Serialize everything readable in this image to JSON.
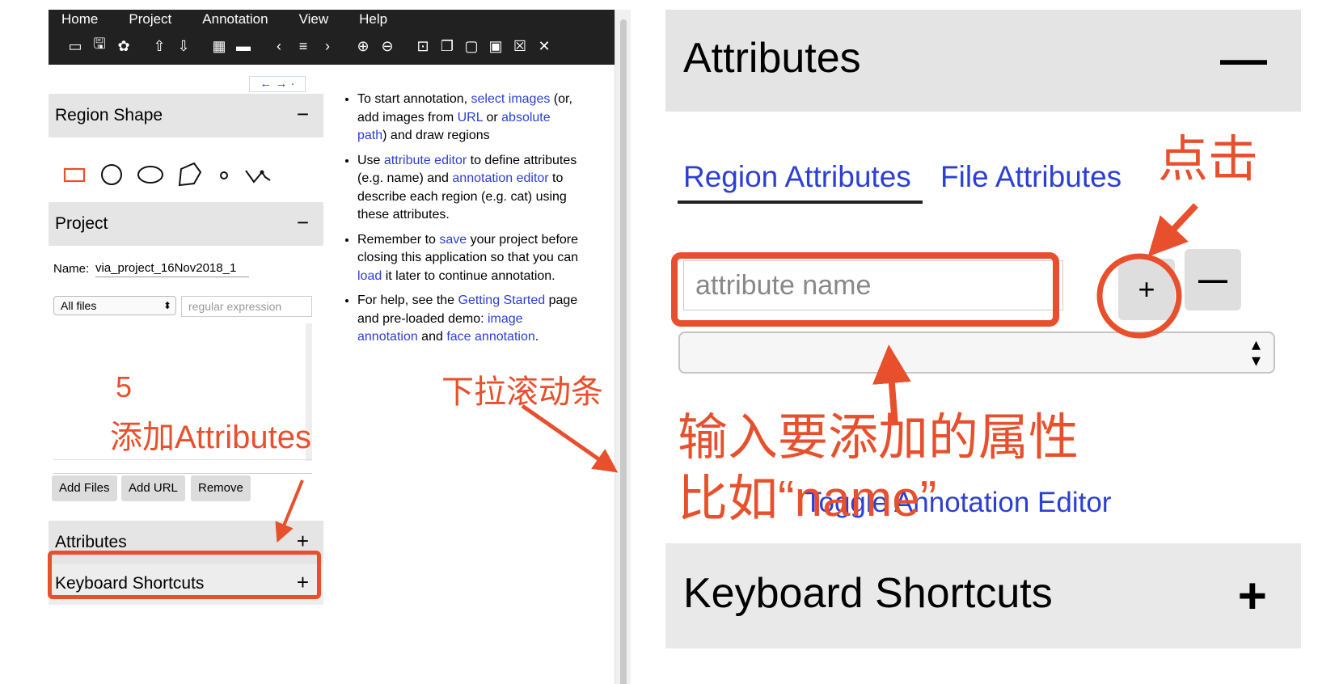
{
  "menu": [
    "Home",
    "Project",
    "Annotation",
    "View",
    "Help"
  ],
  "toolbar_icons": [
    "folder-open-icon",
    "save-icon",
    "settings-icon",
    "upload-icon",
    "download-icon",
    "grid-icon",
    "comment-icon",
    "prev-icon",
    "list-icon",
    "next-icon",
    "zoom-in-icon",
    "zoom-out-icon",
    "select-all-icon",
    "copy-icon",
    "paste-icon",
    "paste-n-icon",
    "delete-icon",
    "close-icon"
  ],
  "toolbar_glyphs": [
    "▭",
    "🖫",
    "✿",
    "⇧",
    "⇩",
    "▦",
    "▬",
    "‹",
    "≡",
    "›",
    "⊕",
    "⊖",
    "⊡",
    "❐",
    "▢",
    "▣",
    "☒",
    "✕"
  ],
  "sidebar": {
    "nav_arrows": "← → ·",
    "region_shape": {
      "title": "Region Shape",
      "toggle": "−"
    },
    "project": {
      "title": "Project",
      "toggle": "−",
      "name_label": "Name:",
      "name_value": "via_project_16Nov2018_1",
      "filter_selected": "All files",
      "regex_placeholder": "regular expression"
    },
    "buttons": {
      "add_files": "Add Files",
      "add_url": "Add URL",
      "remove": "Remove"
    },
    "attributes": {
      "title": "Attributes",
      "toggle": "+"
    },
    "keyboard": {
      "title": "Keyboard Shortcuts",
      "toggle": "+"
    }
  },
  "help": {
    "b1_t1": "To start annotation, ",
    "b1_l1": "select images",
    "b1_t2": " (or, add images from ",
    "b1_l2": "URL",
    "b1_t3": " or ",
    "b1_l3": "absolute path",
    "b1_t4": ") and draw regions",
    "b2_t1": "Use ",
    "b2_l1": "attribute editor",
    "b2_t2": " to define attributes (e.g. name) and ",
    "b2_l2": "annotation editor",
    "b2_t3": " to describe each region (e.g. cat) using these attributes.",
    "b3_t1": "Remember to ",
    "b3_l1": "save",
    "b3_t2": " your project before closing this application so that you can ",
    "b3_l2": "load",
    "b3_t3": " it later to continue annotation.",
    "b4_t1": "For help, see the ",
    "b4_l1": "Getting Started",
    "b4_t2": " page and pre-loaded demo: ",
    "b4_l2": "image annotation",
    "b4_t3": " and ",
    "b4_l3": "face annotation",
    "b4_t4": "."
  },
  "annotations": {
    "step_number": "5",
    "add_attributes": "添加Attributes",
    "scrollbar_hint": "下拉滚动条",
    "click": "点击",
    "input_hint_1": "输入要添加的属性",
    "input_hint_2": "比如“name”"
  },
  "right_panel": {
    "attributes_title": "Attributes",
    "attributes_toggle": "—",
    "tab_region": "Region Attributes",
    "tab_file": "File Attributes",
    "input_placeholder": "attribute name",
    "add_btn": "+",
    "remove_btn": "—",
    "toggle_editor": "Toggle Annotation Editor",
    "keyboard_title": "Keyboard Shortcuts",
    "keyboard_toggle": "+"
  },
  "colors": {
    "annotation_red": "#e8502d",
    "link_blue": "#2c3fd4",
    "topbar": "#212121"
  }
}
